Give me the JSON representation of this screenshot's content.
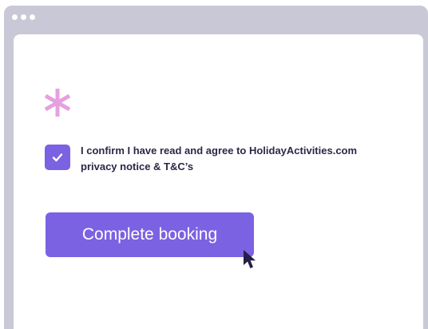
{
  "window": {
    "titlebar_dots": 3
  },
  "form": {
    "required_marker_icon": "asterisk-icon",
    "consent": {
      "checked": true,
      "check_icon": "checkmark-icon",
      "line1": "I confirm I have read and agree to HolidayActivities.com",
      "line2": "privacy notice & T&C’s"
    },
    "submit_label": "Complete booking"
  },
  "colors": {
    "accent": "#7b62e2",
    "asterisk": "#e6a0df",
    "text": "#2a2846",
    "frame": "#c9c8d6",
    "cursor": "#241f45"
  }
}
